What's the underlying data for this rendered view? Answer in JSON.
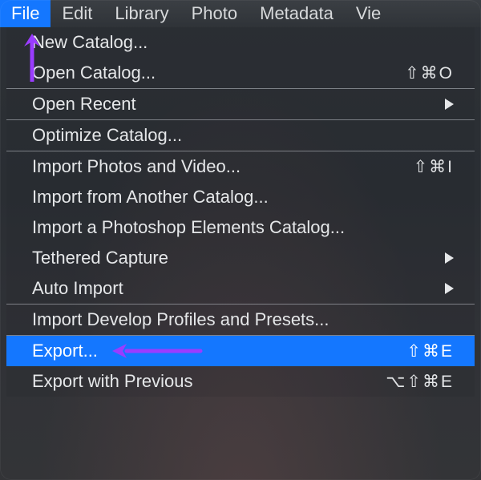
{
  "menubar": {
    "items": [
      {
        "label": "File",
        "active": true
      },
      {
        "label": "Edit",
        "active": false
      },
      {
        "label": "Library",
        "active": false
      },
      {
        "label": "Photo",
        "active": false
      },
      {
        "label": "Metadata",
        "active": false
      },
      {
        "label": "Vie",
        "active": false
      }
    ]
  },
  "dropdown": {
    "items": [
      {
        "label": "New Catalog...",
        "shortcut": "",
        "submenu": false,
        "highlight": false
      },
      {
        "label": "Open Catalog...",
        "shortcut": "⇧⌘O",
        "submenu": false,
        "highlight": false
      },
      {
        "sep": true
      },
      {
        "label": "Open Recent",
        "shortcut": "",
        "submenu": true,
        "highlight": false
      },
      {
        "sep": true
      },
      {
        "label": "Optimize Catalog...",
        "shortcut": "",
        "submenu": false,
        "highlight": false
      },
      {
        "sep": true
      },
      {
        "label": "Import Photos and Video...",
        "shortcut": "⇧⌘I",
        "submenu": false,
        "highlight": false
      },
      {
        "label": "Import from Another Catalog...",
        "shortcut": "",
        "submenu": false,
        "highlight": false
      },
      {
        "label": "Import a Photoshop Elements Catalog...",
        "shortcut": "",
        "submenu": false,
        "highlight": false
      },
      {
        "label": "Tethered Capture",
        "shortcut": "",
        "submenu": true,
        "highlight": false
      },
      {
        "label": "Auto Import",
        "shortcut": "",
        "submenu": true,
        "highlight": false
      },
      {
        "sep": true
      },
      {
        "label": "Import Develop Profiles and Presets...",
        "shortcut": "",
        "submenu": false,
        "highlight": false
      },
      {
        "sep": true
      },
      {
        "label": "Export...",
        "shortcut": "⇧⌘E",
        "submenu": false,
        "highlight": true
      },
      {
        "label": "Export with Previous",
        "shortcut": "⌥⇧⌘E",
        "submenu": false,
        "highlight": false
      }
    ]
  },
  "annotation": {
    "color": "#9a3cff"
  }
}
